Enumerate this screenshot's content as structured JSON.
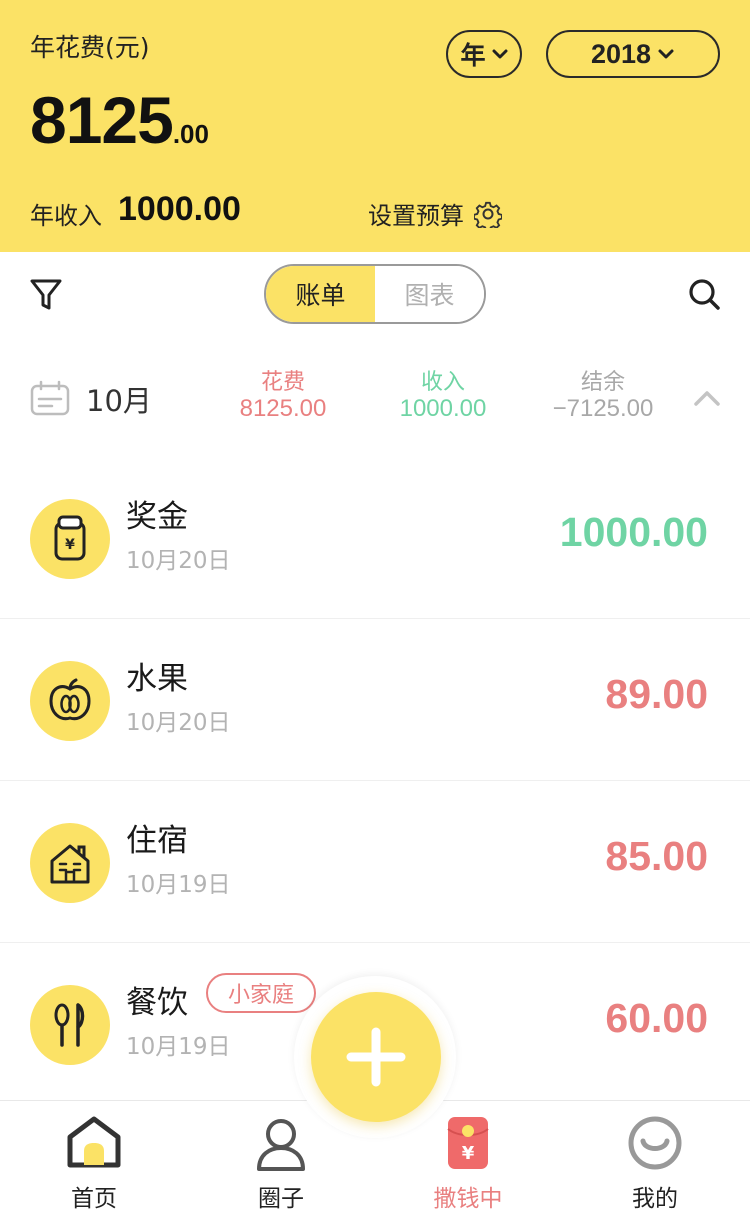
{
  "header": {
    "title": "年花费(元)",
    "amount_int": "8125",
    "amount_dec": ".00",
    "period_label": "年",
    "year": "2018",
    "income_label": "年收入",
    "income_value": "1000.00",
    "budget_label": "设置预算"
  },
  "toolbar": {
    "tabs": [
      {
        "label": "账单",
        "active": true
      },
      {
        "label": "图表",
        "active": false
      }
    ]
  },
  "summary": {
    "month": "10月",
    "expense_label": "花费",
    "expense_value": "8125.00",
    "income_label": "收入",
    "income_value": "1000.00",
    "balance_label": "结余",
    "balance_value": "−7125.00"
  },
  "records": [
    {
      "name": "奖金",
      "date": "10月20日",
      "amount": "1000.00",
      "type": "income",
      "icon": "wallet-icon"
    },
    {
      "name": "水果",
      "date": "10月20日",
      "amount": "89.00",
      "type": "expense",
      "icon": "apple-icon"
    },
    {
      "name": "住宿",
      "date": "10月19日",
      "amount": "85.00",
      "type": "expense",
      "icon": "house-icon"
    },
    {
      "name": "餐饮",
      "date": "10月19日",
      "amount": "60.00",
      "type": "expense",
      "icon": "utensils-icon",
      "tag": "小家庭"
    }
  ],
  "nav": {
    "items": [
      {
        "label": "首页",
        "icon": "home-icon",
        "active": false
      },
      {
        "label": "圈子",
        "icon": "user-icon",
        "active": false
      },
      {
        "label": "撒钱中",
        "icon": "red-envelope-icon",
        "active": true
      },
      {
        "label": "我的",
        "icon": "smile-icon",
        "active": false
      }
    ]
  },
  "colors": {
    "accent": "#FBE266",
    "income": "#6FD4A4",
    "expense": "#E98080",
    "muted": "#B3B3B3"
  }
}
